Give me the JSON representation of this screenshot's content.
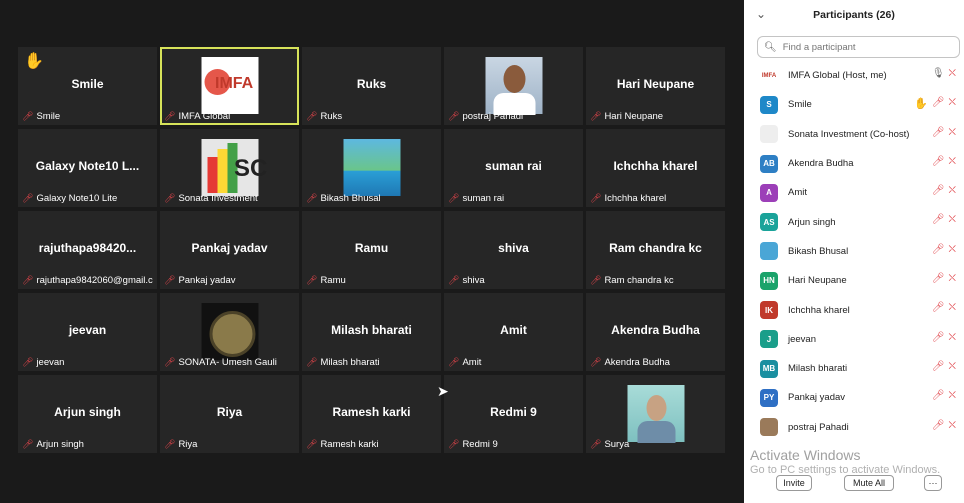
{
  "tiles": [
    {
      "id": "smile",
      "center": "Smile",
      "label": "Smile",
      "hand": "✋"
    },
    {
      "id": "imfa",
      "center": "",
      "label": "IMFA Global",
      "logo": "IMFA"
    },
    {
      "id": "ruks",
      "center": "Ruks",
      "label": "Ruks"
    },
    {
      "id": "postraj",
      "center": "",
      "label": "postraj Pahadi"
    },
    {
      "id": "hari",
      "center": "Hari Neupane",
      "label": "Hari Neupane"
    },
    {
      "id": "galaxy",
      "center": "Galaxy Note10 L...",
      "label": "Galaxy Note10 Lite"
    },
    {
      "id": "sonata",
      "center": "",
      "label": "Sonata Investment"
    },
    {
      "id": "bikash",
      "center": "",
      "label": "Bikash Bhusal"
    },
    {
      "id": "suman",
      "center": "suman rai",
      "label": "suman rai"
    },
    {
      "id": "ichchha",
      "center": "Ichchha kharel",
      "label": "Ichchha kharel"
    },
    {
      "id": "raju",
      "center": "rajuthapa98420...",
      "label": "rajuthapa9842060@gmail.c..."
    },
    {
      "id": "pankaj",
      "center": "Pankaj yadav",
      "label": "Pankaj yadav"
    },
    {
      "id": "ramu",
      "center": "Ramu",
      "label": "Ramu"
    },
    {
      "id": "shiva",
      "center": "shiva",
      "label": "shiva"
    },
    {
      "id": "ramck",
      "center": "Ram chandra kc",
      "label": "Ram chandra kc"
    },
    {
      "id": "jeevan",
      "center": "jeevan",
      "label": "jeevan"
    },
    {
      "id": "umesh",
      "center": "",
      "label": "SONATA- Umesh Gauli"
    },
    {
      "id": "milash",
      "center": "Milash bharati",
      "label": "Milash bharati"
    },
    {
      "id": "amit",
      "center": "Amit",
      "label": "Amit"
    },
    {
      "id": "akendra",
      "center": "Akendra Budha",
      "label": "Akendra Budha"
    },
    {
      "id": "arjun",
      "center": "Arjun singh",
      "label": "Arjun singh"
    },
    {
      "id": "riya",
      "center": "Riya",
      "label": "Riya"
    },
    {
      "id": "ramesh",
      "center": "Ramesh karki",
      "label": "Ramesh karki"
    },
    {
      "id": "redmi",
      "center": "Redmi 9",
      "label": "Redmi 9"
    },
    {
      "id": "surya",
      "center": "",
      "label": "Surya"
    }
  ],
  "panel": {
    "title": "Participants (26)",
    "search_placeholder": "Find a participant",
    "participants": [
      {
        "name": "IMFA Global (Host, me)",
        "initials": "IMFA",
        "color": "#ffffff"
      },
      {
        "name": "Smile",
        "initials": "S",
        "color": "#1e88c8"
      },
      {
        "name": "Sonata Investment (Co-host)",
        "initials": "",
        "color": "#eeeeee"
      },
      {
        "name": "Akendra Budha",
        "initials": "AB",
        "color": "#2e7fc4"
      },
      {
        "name": "Amit",
        "initials": "A",
        "color": "#9c3fb8"
      },
      {
        "name": "Arjun singh",
        "initials": "AS",
        "color": "#1aa39a"
      },
      {
        "name": "Bikash Bhusal",
        "initials": "",
        "color": "#4aa6d6"
      },
      {
        "name": "Hari Neupane",
        "initials": "HN",
        "color": "#1aa36a"
      },
      {
        "name": "Ichchha kharel",
        "initials": "IK",
        "color": "#c0392b"
      },
      {
        "name": "jeevan",
        "initials": "J",
        "color": "#1a9e8a"
      },
      {
        "name": "Milash bharati",
        "initials": "MB",
        "color": "#1a8fa0"
      },
      {
        "name": "Pankaj yadav",
        "initials": "PY",
        "color": "#2e6fc4"
      },
      {
        "name": "postraj Pahadi",
        "initials": "",
        "color": "#9a7a5a"
      }
    ],
    "watermark_title": "Activate Windows",
    "watermark_sub": "Go to PC settings to activate Windows.",
    "invite_label": "Invite",
    "mute_all_label": "Mute All",
    "more_label": "···"
  }
}
